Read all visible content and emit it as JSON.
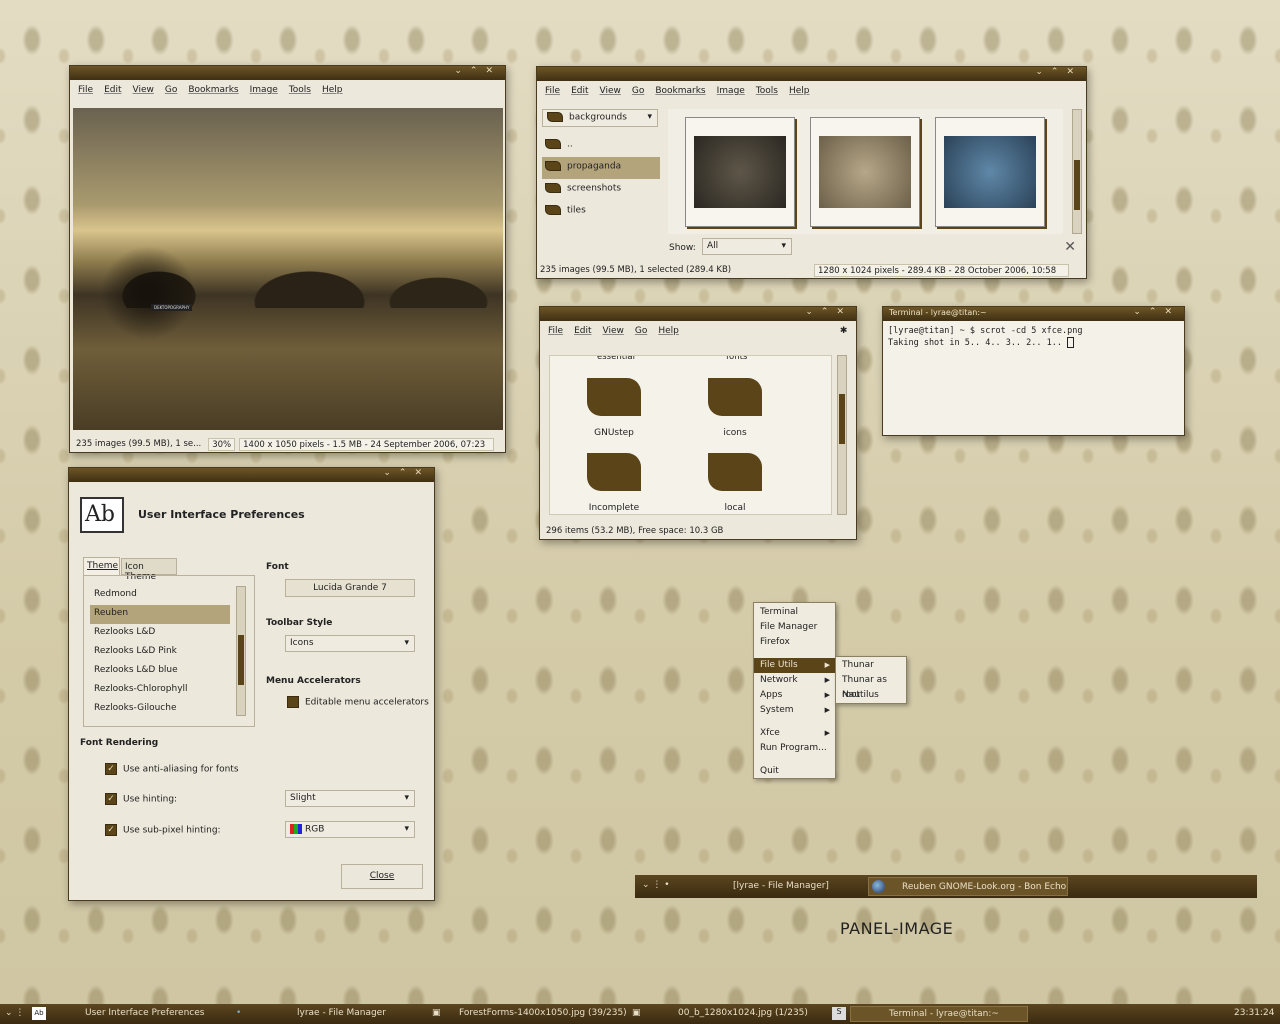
{
  "viewer1": {
    "menu": [
      "File",
      "Edit",
      "View",
      "Go",
      "Bookmarks",
      "Image",
      "Tools",
      "Help"
    ],
    "status": [
      "235 images (99.5 MB), 1 se...",
      "30%",
      "1400 x 1050 pixels - 1.5 MB - 24 September 2006, 07:23"
    ],
    "overlay": "DEKTOPOGRAPHY"
  },
  "viewer2": {
    "menu": [
      "File",
      "Edit",
      "View",
      "Go",
      "Bookmarks",
      "Image",
      "Tools",
      "Help"
    ],
    "location": "backgrounds",
    "folders": [
      "..",
      "propaganda",
      "screenshots",
      "tiles"
    ],
    "show_label": "Show:",
    "show_value": "All",
    "status": [
      "235 images (99.5 MB), 1 selected (289.4 KB)",
      "1280 x 1024 pixels - 289.4 KB - 28 October 2006, 10:58"
    ]
  },
  "fm": {
    "menu": [
      "File",
      "Edit",
      "View",
      "Go",
      "Help"
    ],
    "top_cut": [
      "essential",
      "fonts"
    ],
    "items": [
      "GNUstep",
      "icons",
      "Incomplete",
      "local"
    ],
    "status": "296 items (53.2 MB), Free space: 10.3 GB"
  },
  "terminal": {
    "title": "Terminal - lyrae@titan:~",
    "line1": "[lyrae@titan] ~ $ scrot -cd 5 xfce.png",
    "line2": "Taking shot in 5.. 4.. 3.. 2.. 1.. "
  },
  "prefs": {
    "title": "User Interface Preferences",
    "tabs": [
      "Theme",
      "Icon Theme"
    ],
    "themes": [
      "Redmond",
      "Reuben",
      "Rezlooks L&D",
      "Rezlooks L&D Pink",
      "Rezlooks L&D blue",
      "Rezlooks-Chlorophyll",
      "Rezlooks-Gilouche"
    ],
    "font_label": "Font",
    "font_value": "Lucida Grande 7",
    "toolbar_label": "Toolbar Style",
    "toolbar_value": "Icons",
    "accel_label": "Menu Accelerators",
    "accel_check": "Editable menu accelerators",
    "render_label": "Font Rendering",
    "aa": "Use anti-aliasing for fonts",
    "hint": "Use hinting:",
    "hint_value": "Slight",
    "sub": "Use sub-pixel hinting:",
    "sub_value": "RGB",
    "close": "Close"
  },
  "rootmenu": {
    "items": [
      "Terminal",
      "File Manager",
      "Firefox",
      "File Utils",
      "Network",
      "Apps",
      "System",
      "Xfce",
      "Run Program...",
      "Quit"
    ],
    "sub": [
      "Thunar",
      "Thunar as root",
      "Nautilus"
    ]
  },
  "panel_float": {
    "task1": "[lyrae - File Manager]",
    "task2": "Reuben GNOME-Look.org - Bon Echo"
  },
  "panel_image_label": "PANEL-IMAGE",
  "taskbar": {
    "items": [
      "User Interface Preferences",
      "lyrae - File Manager",
      "ForestForms-1400x1050.jpg (39/235)",
      "00_b_1280x1024.jpg (1/235)",
      "Terminal - lyrae@titan:~"
    ],
    "clock": "23:31:24"
  },
  "colors": {
    "accent": "#5a4418",
    "titlebar": "#4a3816",
    "window": "#ece8dc"
  }
}
